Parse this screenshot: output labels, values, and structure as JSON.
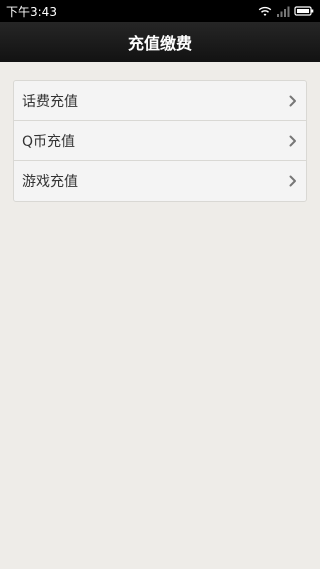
{
  "status_bar": {
    "time": "下午3:43",
    "icons": [
      "wifi-icon",
      "signal-icon",
      "battery-icon"
    ]
  },
  "header": {
    "title": "充值缴费"
  },
  "menu": {
    "items": [
      {
        "label": "话费充值",
        "icon": "chevron-right-icon"
      },
      {
        "label": "Q币充值",
        "icon": "chevron-right-icon"
      },
      {
        "label": "游戏充值",
        "icon": "chevron-right-icon"
      }
    ]
  },
  "colors": {
    "background": "#eeece8",
    "header": "#1a1a1a",
    "menu_bg": "#f4f4f4",
    "divider": "#d9d8d4",
    "chevron": "#777777"
  }
}
